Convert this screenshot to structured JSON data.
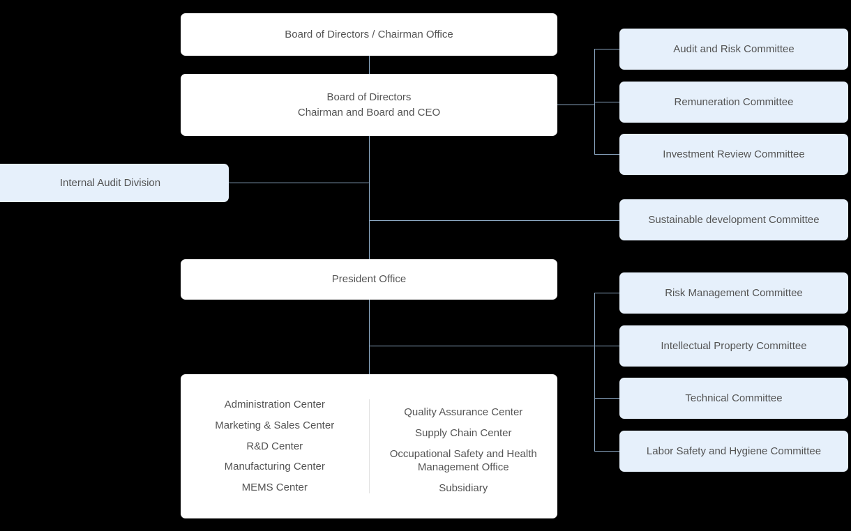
{
  "meta": {
    "diagram_title": "Corporate Organization Chart",
    "background_color": "#000000",
    "primary_node_color": "#ffffff",
    "committee_node_color": "#e6f0fb",
    "connector_color": "#8da9c4",
    "text_color": "#545454"
  },
  "nodes": {
    "board_chairman_office": {
      "label": "Board of Directors / Chairman Office"
    },
    "board_directors_ceo": {
      "label": "Board of Directors\nChairman and Board and CEO"
    },
    "president_office": {
      "label": "President Office"
    },
    "internal_audit": {
      "label": "Internal Audit Division"
    }
  },
  "board_committees": [
    {
      "label": "Audit and Risk Committee"
    },
    {
      "label": "Remuneration Committee"
    },
    {
      "label": "Investment Review Committee"
    }
  ],
  "standalone_committees": [
    {
      "label": "Sustainable development Committee"
    }
  ],
  "president_committees": [
    {
      "label": "Risk Management Committee"
    },
    {
      "label": "Intellectual Property Committee"
    },
    {
      "label": "Technical Committee"
    },
    {
      "label": "Labor Safety and Hygiene Committee"
    }
  ],
  "departments": {
    "left_column": [
      {
        "label": "Administration Center"
      },
      {
        "label": "Marketing & Sales Center"
      },
      {
        "label": "R&D Center"
      },
      {
        "label": "Manufacturing Center"
      },
      {
        "label": "MEMS Center"
      }
    ],
    "right_column": [
      {
        "label": "Quality Assurance Center"
      },
      {
        "label": "Supply Chain Center"
      },
      {
        "label": "Occupational Safety and Health\nManagement Office"
      },
      {
        "label": "Subsidiary"
      }
    ]
  }
}
